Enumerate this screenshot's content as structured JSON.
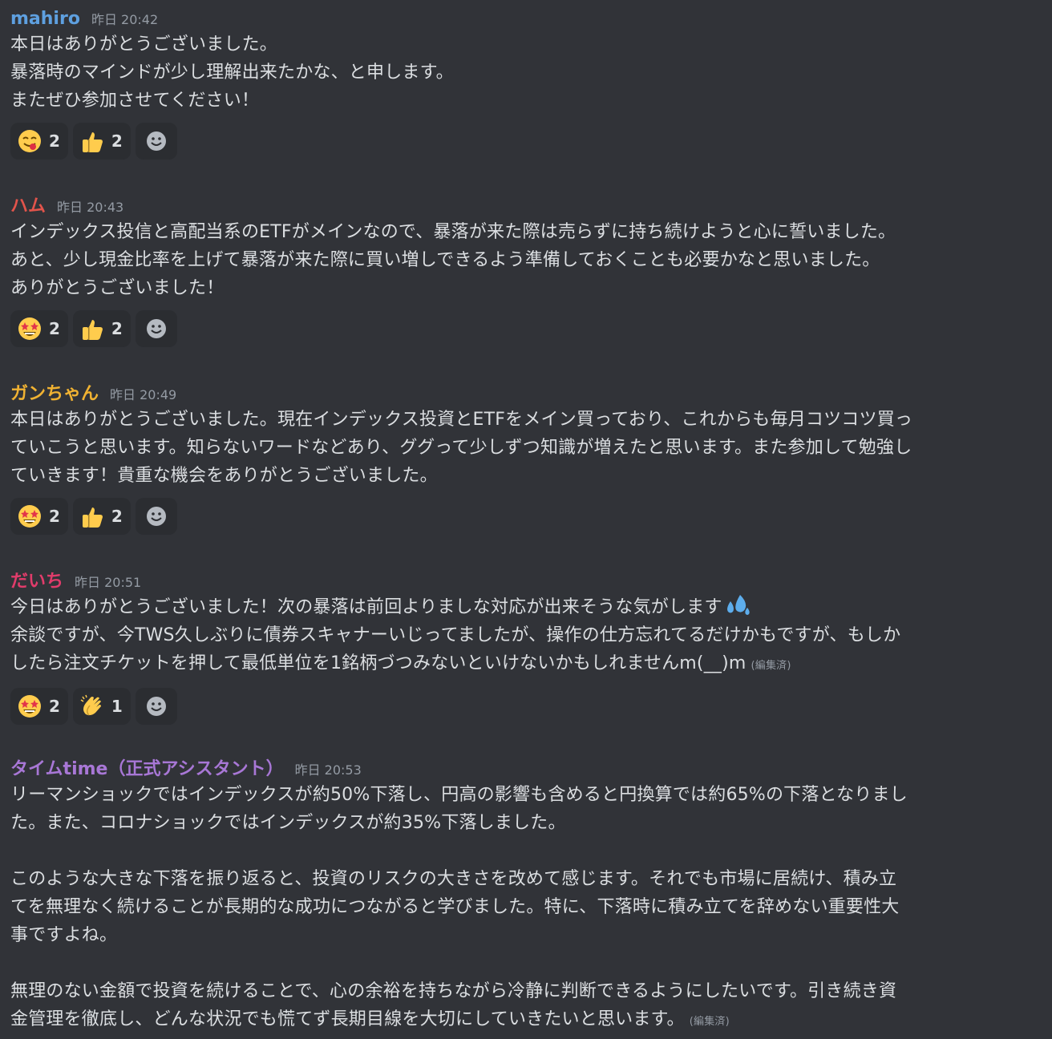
{
  "colors": {
    "background": "#313338",
    "reaction_bg": "#2b2d31",
    "text": "#dbdee1",
    "muted": "#949ba4"
  },
  "messages": [
    {
      "author": "mahiro",
      "author_color": "#5ea0e0",
      "timestamp": "昨日 20:42",
      "lines": [
        "本日はありがとうございました。",
        "暴落時のマインドが少し理解出来たかな、と申します。",
        "またぜひ参加させてください！"
      ],
      "reactions": [
        {
          "emoji": "yum-face-icon",
          "count": "2"
        },
        {
          "emoji": "thumbs-up-icon",
          "count": "2"
        }
      ]
    },
    {
      "author": "ハム",
      "author_color": "#e2544b",
      "timestamp": "昨日 20:43",
      "lines": [
        "インデックス投信と高配当系のETFがメインなので、暴落が来た際は売らずに持ち続けようと心に誓いました。",
        "あと、少し現金比率を上げて暴落が来た際に買い増しできるよう準備しておくことも必要かなと思いました。",
        "ありがとうございました！"
      ],
      "reactions": [
        {
          "emoji": "star-struck-icon",
          "count": "2"
        },
        {
          "emoji": "thumbs-up-icon",
          "count": "2"
        }
      ]
    },
    {
      "author": "ガンちゃん",
      "author_color": "#f0b232",
      "timestamp": "昨日 20:49",
      "lines": [
        "本日はありがとうございました。現在インデックス投資とETFをメイン買っており、これからも毎月コツコツ買っ",
        "ていこうと思います。知らないワードなどあり、ググって少しずつ知識が増えたと思います。また参加して勉強し",
        "ていきます！貴重な機会をありがとうございました。"
      ],
      "reactions": [
        {
          "emoji": "star-struck-icon",
          "count": "2"
        },
        {
          "emoji": "thumbs-up-icon",
          "count": "2"
        }
      ]
    },
    {
      "author": "だいち",
      "author_color": "#e13c6b",
      "timestamp": "昨日 20:51",
      "lines": [
        "今日はありがとうございました！次の暴落は前回よりましな対応が出来そうな気がします",
        "余談ですが、今TWS久しぶりに債券スキャナーいじってましたが、操作の仕方忘れてるだけかもですが、もしか",
        "したら注文チケットを押して最低単位を1銘柄づつみないといけないかもしれませんm(__)m"
      ],
      "edited": "(編集済)",
      "reactions": [
        {
          "emoji": "star-struck-icon",
          "count": "2"
        },
        {
          "emoji": "clapping-hands-icon",
          "count": "1"
        }
      ]
    },
    {
      "author": "タイムtime（正式アシスタント）",
      "author_color": "#a877d6",
      "timestamp": "昨日 20:53",
      "lines": [
        "リーマンショックではインデックスが約50%下落し、円高の影響も含めると円換算では約65%の下落となりまし",
        "た。また、コロナショックではインデックスが約35%下落しました。",
        "",
        "このような大きな下落を振り返ると、投資のリスクの大きさを改めて感じます。それでも市場に居続け、積み立",
        "てを無理なく続けることが長期的な成功につながると学びました。特に、下落時に積み立てを辞めない重要性大",
        "事ですよね。",
        "",
        "無理のない金額で投資を続けることで、心の余裕を持ちながら冷静に判断できるようにしたいです。引き続き資",
        "金管理を徹底し、どんな状況でも慌てず長期目線を大切にしていきたいと思います。"
      ],
      "edited": "(編集済)"
    }
  ]
}
